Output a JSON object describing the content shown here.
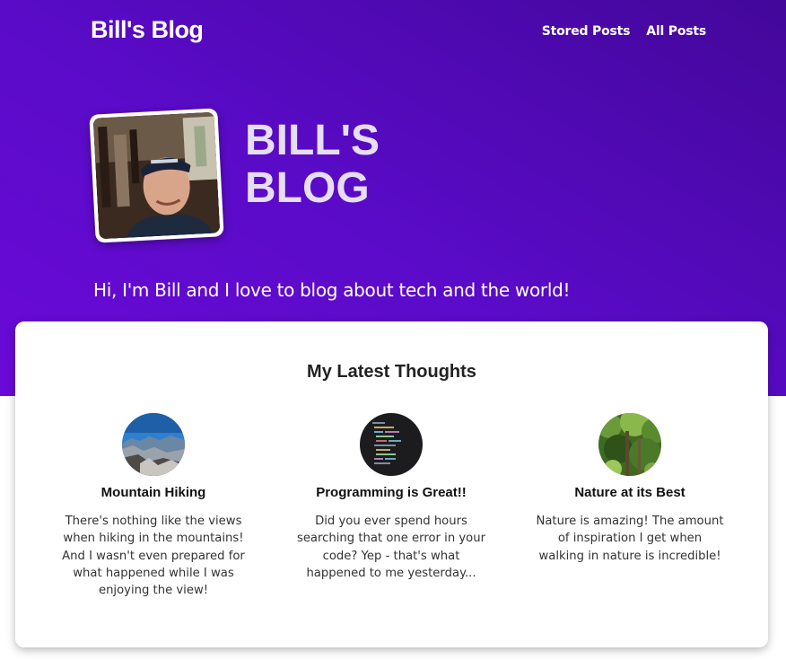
{
  "header": {
    "brand": "Bill's Blog",
    "nav": [
      "Stored Posts",
      "All Posts"
    ]
  },
  "hero": {
    "title_line1": "Bill's",
    "title_line2": "Blog",
    "tagline": "Hi, I'm Bill and I love to blog about tech and the world!"
  },
  "latest": {
    "heading": "My Latest Thoughts",
    "posts": [
      {
        "title": "Mountain Hiking",
        "excerpt": "There's nothing like the views when hiking in the mountains! And I wasn't even prepared for what happened while I was enjoying the view!"
      },
      {
        "title": "Programming is Great!!",
        "excerpt": "Did you ever spend hours searching that one error in your code? Yep - that's what happened to me yesterday..."
      },
      {
        "title": "Nature at its Best",
        "excerpt": "Nature is amazing! The amount of inspiration I get when walking in nature is incredible!"
      }
    ]
  },
  "colors": {
    "hero_dark": "#43079a",
    "hero_light": "#6a0ad8",
    "title_text": "#e6def5"
  }
}
